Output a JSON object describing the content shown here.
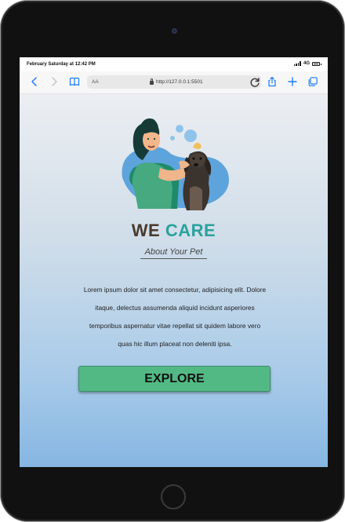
{
  "status_bar": {
    "time": "February Saturday at 12:42 PM",
    "network": "4G"
  },
  "browser": {
    "text_size_label": "AA",
    "url": "http://127.0.0.1:5501"
  },
  "hero": {
    "brand_part1": "WE",
    "brand_part2": "CARE",
    "tagline": "About Your Pet"
  },
  "description_lines": [
    "Lorem ipsum dolor sit amet consectetur, adipisicing elit. Dolore",
    "itaque, delectus assumenda aliquid incidunt asperiores",
    "temporibus aspernatur vitae repellat sit quidem labore vero",
    "quas hic illum placeat non deleniti ipsa."
  ],
  "cta": {
    "label": "EXPLORE"
  },
  "colors": {
    "accent_green": "#52b985",
    "brand_teal": "#2ba19c",
    "brand_brown": "#4a3a2c",
    "link_blue": "#1a7cff"
  },
  "icons": [
    "back-icon",
    "forward-icon",
    "bookmarks-icon",
    "lock-icon",
    "reload-icon",
    "share-icon",
    "new-tab-icon",
    "tabs-icon"
  ]
}
